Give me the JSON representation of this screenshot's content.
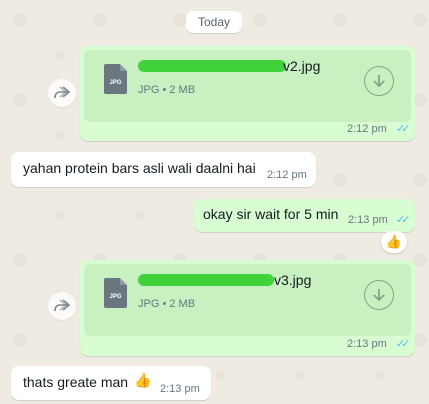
{
  "date_separator": "Today",
  "colors": {
    "chat_bg": "#efeae2",
    "outgoing_bubble": "#d9fdd3",
    "incoming_bubble": "#ffffff",
    "read_ticks": "#53bdeb",
    "scribble": "#3fd23b"
  },
  "messages": [
    {
      "type": "document",
      "direction": "outgoing",
      "icon": "jpg-file-icon",
      "icon_label": "JPG",
      "name_visible_suffix": "v2.jpg",
      "meta": "JPG • 2 MB",
      "time": "2:12 pm",
      "status_ticks": "✓✓"
    },
    {
      "type": "text",
      "direction": "incoming",
      "text": "yahan protein bars asli wali daalni hai",
      "time": "2:12 pm"
    },
    {
      "type": "text",
      "direction": "outgoing",
      "text": "okay sir wait for 5 min",
      "time": "2:13 pm",
      "status_ticks": "✓✓",
      "reaction": "👍"
    },
    {
      "type": "document",
      "direction": "outgoing",
      "icon": "jpg-file-icon",
      "icon_label": "JPG",
      "name_visible_suffix": "v3.jpg",
      "meta": "JPG • 2 MB",
      "time": "2:13 pm",
      "status_ticks": "✓✓"
    },
    {
      "type": "text",
      "direction": "incoming",
      "text": "thats greate man",
      "emoji": "👍",
      "time": "2:13 pm"
    }
  ]
}
